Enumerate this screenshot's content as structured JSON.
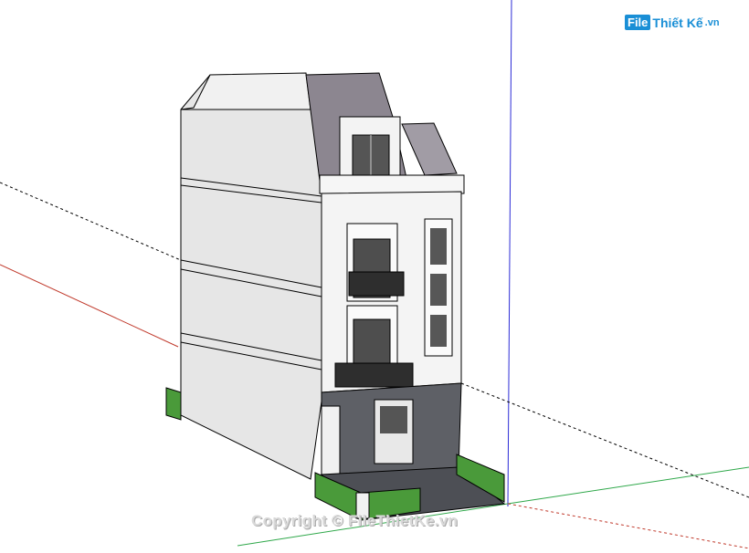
{
  "watermark": {
    "logo_badge": "File",
    "logo_text": "Thiết Kế",
    "logo_ext": ".vn",
    "copyright": "Copyright © FileThietKe.vn"
  },
  "colors": {
    "axis_red": "#c0392b",
    "axis_green": "#2fa84a",
    "axis_blue": "#2b2bd6",
    "wall": "#e9e9e9",
    "wall_shade": "#d0d0d0",
    "roof": "#8e8890",
    "lawn": "#4a9a3a",
    "brand": "#1a8fd6"
  },
  "scene": {
    "subject": "three-storey townhouse 3D model",
    "icons": [
      "model-building",
      "axis-lines",
      "logo-icon"
    ]
  }
}
